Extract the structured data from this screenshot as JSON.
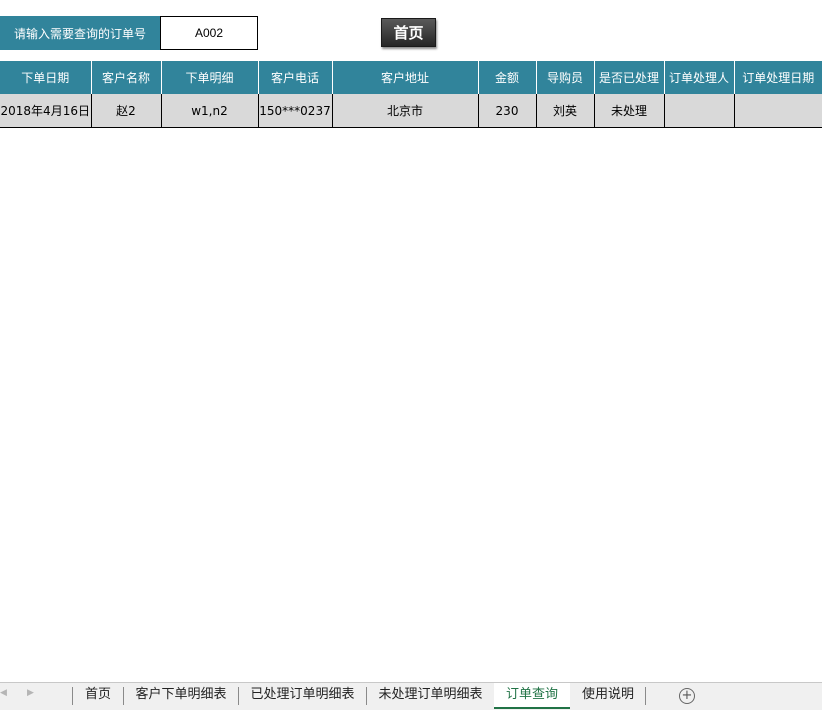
{
  "query": {
    "label": "请输入需要查询的订单号",
    "value": "A002"
  },
  "home_button": "首页",
  "table": {
    "headers": [
      "下单日期",
      "客户名称",
      "下单明细",
      "客户电话",
      "客户地址",
      "金额",
      "导购员",
      "是否已处理",
      "订单处理人",
      "订单处理日期"
    ],
    "rows": [
      [
        "2018年4月16日",
        "赵2",
        "w1,n2",
        "150***0237",
        "北京市",
        "230",
        "刘英",
        "未处理",
        "",
        ""
      ]
    ]
  },
  "sheet_tabs": {
    "tabs": [
      "首页",
      "客户下单明细表",
      "已处理订单明细表",
      "未处理订单明细表",
      "订单查询",
      "使用说明"
    ],
    "active": "订单查询",
    "nav_prev_icon": "triangle-left-icon",
    "nav_next_icon": "triangle-right-icon",
    "add_icon": "plus-circle-icon"
  },
  "colors": {
    "header_bg": "#31849b",
    "row_bg": "#d9d9d9",
    "active_tab": "#217346"
  }
}
